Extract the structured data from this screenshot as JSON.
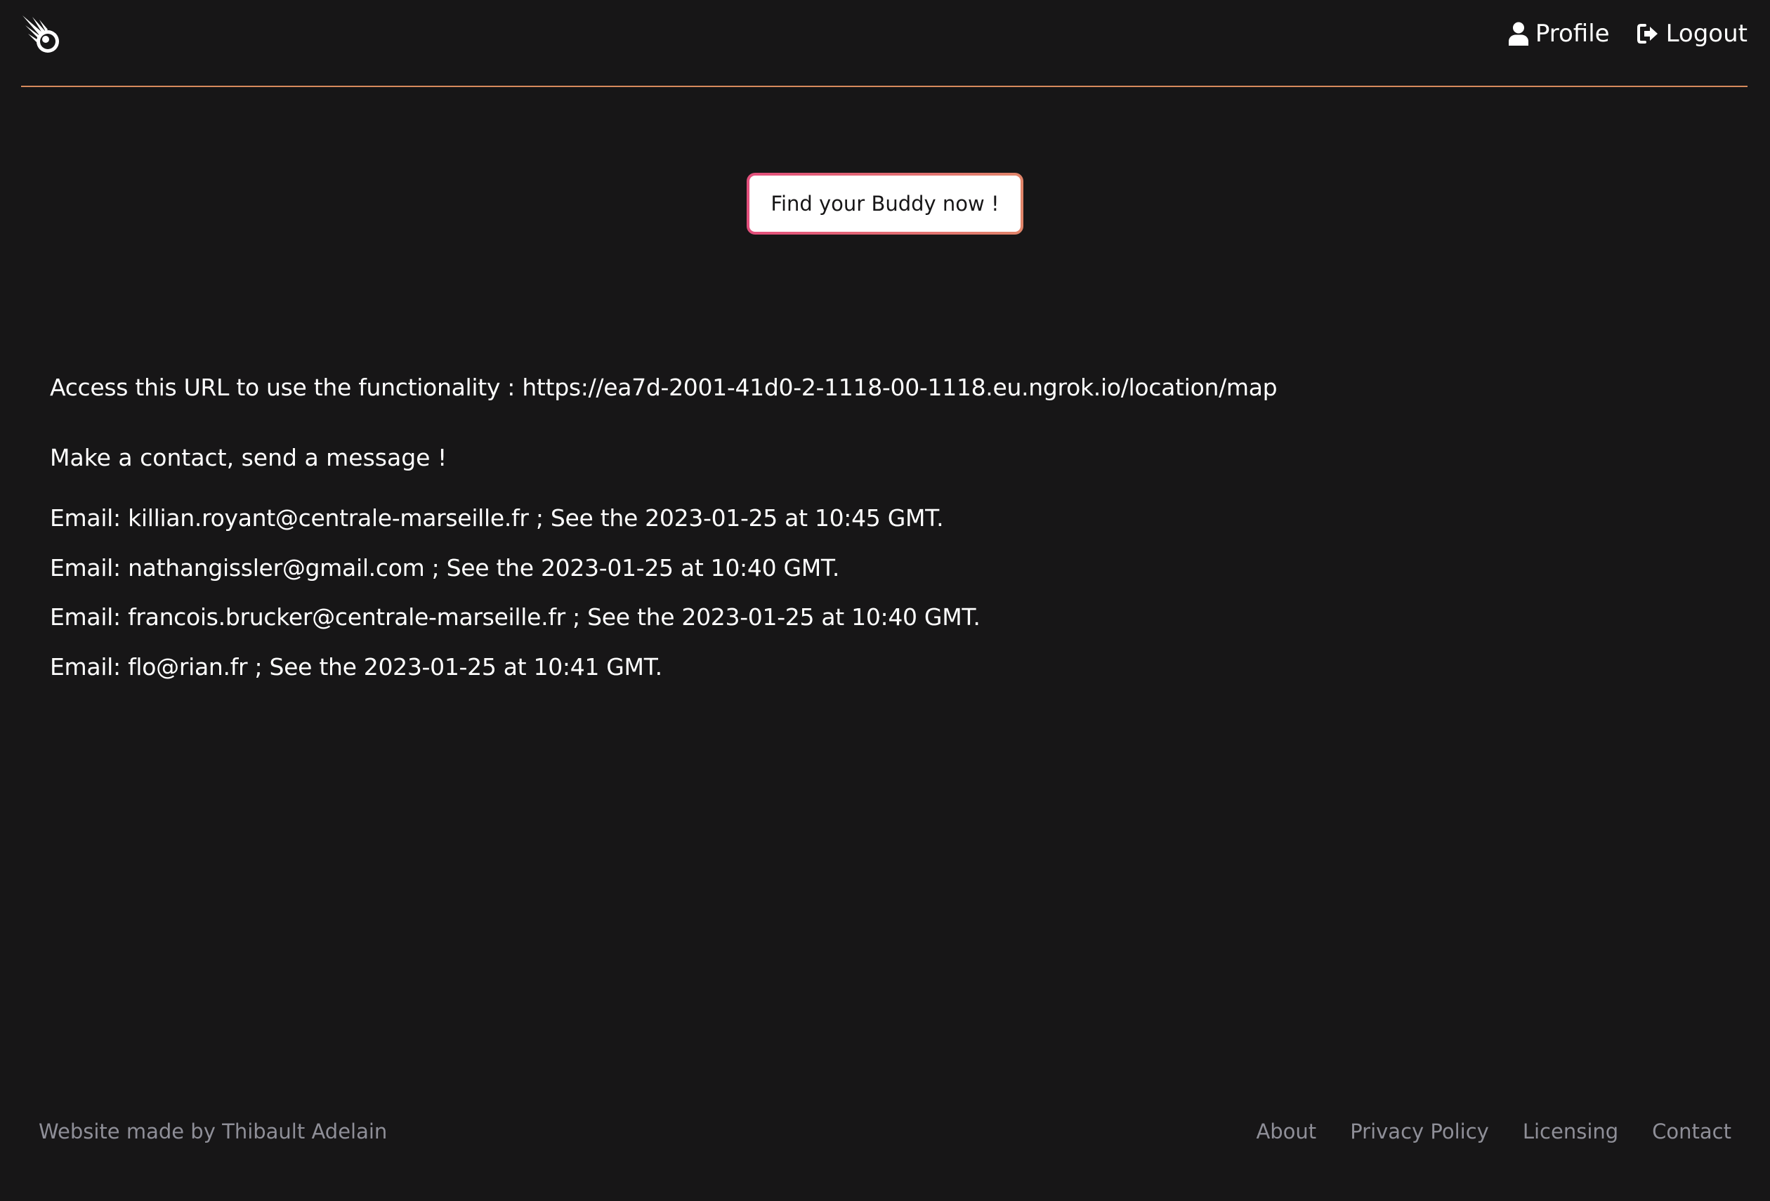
{
  "header": {
    "logo_icon": "comet-logo-icon",
    "nav": [
      {
        "icon": "user-icon",
        "label": "Profile"
      },
      {
        "icon": "logout-icon",
        "label": "Logout"
      }
    ],
    "accent_color": "#d78a5d"
  },
  "cta": {
    "label": "Find your Buddy now !",
    "border_gradient": [
      "#e34f7c",
      "#e1856a"
    ]
  },
  "main": {
    "url_line": "Access this URL to use the functionality : https://ea7d-2001-41d0-2-1118-00-1118.eu.ngrok.io/location/map",
    "contact_heading": "Make a contact, send a message !",
    "contacts": [
      "Email: killian.royant@centrale-marseille.fr ; See the 2023-01-25 at 10:45 GMT.",
      "Email: nathangissler@gmail.com ; See the 2023-01-25 at 10:40 GMT.",
      "Email: francois.brucker@centrale-marseille.fr ; See the 2023-01-25 at 10:40 GMT.",
      "Email: flo@rian.fr ; See the 2023-01-25 at 10:41 GMT."
    ]
  },
  "footer": {
    "credit": "Website made by Thibault Adelain",
    "links": [
      "About",
      "Privacy Policy",
      "Licensing",
      "Contact"
    ]
  },
  "colors": {
    "background": "#171617",
    "text": "#ffffff",
    "muted": "#8f8f98"
  }
}
